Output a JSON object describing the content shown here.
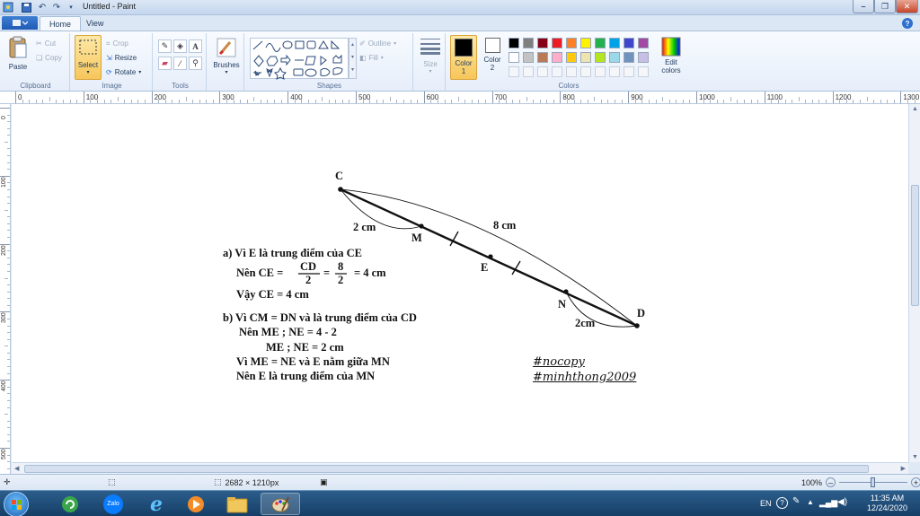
{
  "window": {
    "title": "Untitled - Paint"
  },
  "tabs": [
    {
      "label": "Home"
    },
    {
      "label": "View"
    }
  ],
  "ribbon": {
    "clipboard": {
      "label": "Clipboard",
      "paste": "Paste",
      "cut": "Cut",
      "copy": "Copy"
    },
    "image": {
      "label": "Image",
      "select": "Select",
      "crop": "Crop",
      "resize": "Resize",
      "rotate": "Rotate"
    },
    "tools": {
      "label": "Tools"
    },
    "brushes": {
      "label": "Brushes"
    },
    "shapes": {
      "label": "Shapes",
      "outline": "Outline",
      "fill": "Fill"
    },
    "size": {
      "label": "Size"
    },
    "colors": {
      "label": "Colors",
      "color1": "Color 1",
      "color2": "Color 2",
      "edit": "Edit colors",
      "palette_row1": [
        "#000000",
        "#7f7f7f",
        "#880015",
        "#ed1c24",
        "#ff7f27",
        "#fff200",
        "#22b14c",
        "#00a2e8",
        "#3f48cc",
        "#a349a4"
      ],
      "palette_row2": [
        "#ffffff",
        "#c3c3c3",
        "#b97a57",
        "#ffaec9",
        "#ffc90e",
        "#efe4b0",
        "#b5e61d",
        "#99d9ea",
        "#7092be",
        "#c8bfe7"
      ]
    }
  },
  "ruler": {
    "h_labels": [
      "0",
      "100",
      "200",
      "300",
      "400",
      "500",
      "600",
      "700",
      "800",
      "900",
      "1000",
      "1100",
      "1200",
      "1300"
    ],
    "v_labels": [
      "0",
      "100",
      "200",
      "300",
      "400",
      "500"
    ]
  },
  "drawing": {
    "points": {
      "c": "C",
      "m": "M",
      "e": "E",
      "n": "N",
      "d": "D"
    },
    "labels": {
      "cm2_left": "2 cm",
      "cm8": "8 cm",
      "cm2_right": "2cm"
    },
    "part_a": {
      "line1": "a) Vì E là trung điểm của CE",
      "line2_prefix": "Nên CE =",
      "frac1_num": "CD",
      "frac1_den": "2",
      "eq": "=",
      "frac2_num": "8",
      "frac2_den": "2",
      "line2_suffix": "= 4 cm",
      "line3": "Vậy CE = 4 cm"
    },
    "part_b": {
      "line1": "b) Vì CM = DN và là trung điểm của CD",
      "line2": "Nên ME ; NE = 4 - 2",
      "line3": "ME ; NE = 2 cm",
      "line4": "Vì  ME = NE và E nằm giữa MN",
      "line5": "Nên E là trung điểm của MN"
    },
    "hashtags": [
      "#nocopy",
      "#minhthong2009"
    ]
  },
  "statusbar": {
    "dimensions": "2682 × 1210px",
    "zoom": "100%"
  },
  "taskbar": {
    "language": "EN",
    "time": "11:35 AM",
    "date": "12/24/2020",
    "zalo_label": "Zalo"
  }
}
